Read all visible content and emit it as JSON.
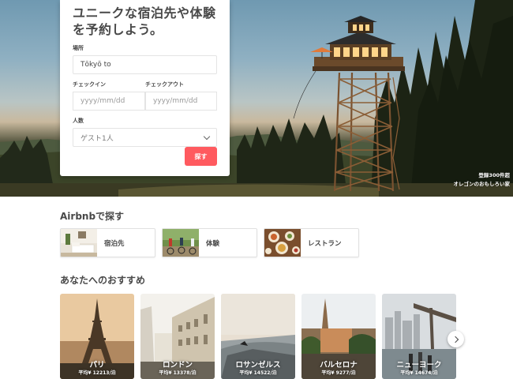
{
  "search": {
    "title": "ユニークな宿泊先や体験を予約しよう。",
    "place_label": "場所",
    "place_value": "Tōkyō to",
    "checkin_label": "チェックイン",
    "checkin_placeholder": "yyyy/mm/dd",
    "checkout_label": "チェックアウト",
    "checkout_placeholder": "yyyy/mm/dd",
    "guests_label": "人数",
    "guests_value": "ゲスト1人",
    "submit_label": "探す"
  },
  "hero": {
    "caption_line1": "登録300件超",
    "caption_line2": "オレゴンのおもしろい家"
  },
  "explore": {
    "title": "Airbnbで探す",
    "items": [
      {
        "label": "宿泊先",
        "icon": "room-photo"
      },
      {
        "label": "体験",
        "icon": "cyclists-photo"
      },
      {
        "label": "レストラン",
        "icon": "food-photo"
      }
    ]
  },
  "recommend": {
    "title": "あなたへのおすすめ",
    "cities": [
      {
        "name": "パリ",
        "price": "平均¥ 12213/泊"
      },
      {
        "name": "ロンドン",
        "price": "平均¥ 13378/泊"
      },
      {
        "name": "ロサンゼルス",
        "price": "平均¥ 14522/泊"
      },
      {
        "name": "バルセロナ",
        "price": "平均¥ 9277/泊"
      },
      {
        "name": "ニューヨーク",
        "price": "平均¥ 14674/泊"
      }
    ]
  },
  "colors": {
    "accent": "#ff5a5f",
    "text": "#484848"
  }
}
